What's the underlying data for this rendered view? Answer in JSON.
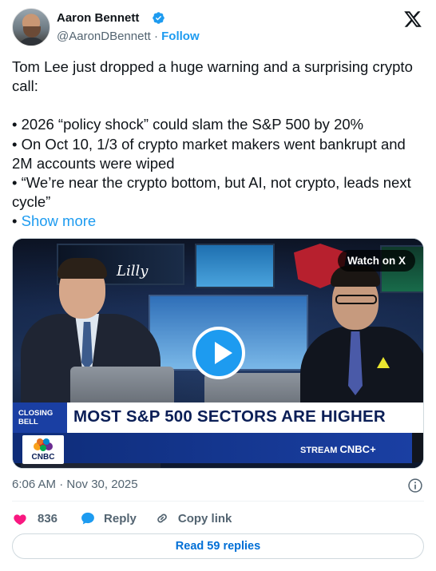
{
  "author": {
    "name": "Aaron Bennett",
    "handle": "@AaronDBennett",
    "separator": "·",
    "follow_label": "Follow",
    "verified_icon": "verified-badge-icon",
    "brand_icon": "x-logo-icon"
  },
  "tweet": {
    "lines": [
      "Tom Lee just dropped a huge warning and a surprising crypto call:",
      "• 2026 “policy shock” could slam the S&P 500 by 20%",
      "• On Oct 10, 1/3 of crypto market makers went bankrupt and 2M accounts were wiped",
      "• “We’re near the crypto bottom, but AI, not crypto, leads next cycle”"
    ],
    "show_more_prefix": "• ",
    "show_more_label": "Show more"
  },
  "media": {
    "watch_label": "Watch on X",
    "chyron_tag": "CLOSING BELL",
    "headline": "MOST S&P 500 SECTORS ARE HIGHER",
    "network": "CNBC",
    "stream_prefix": "STREAM",
    "stream_brand": "CNBC+",
    "screen_logo": "Lilly",
    "play_icon": "play-icon"
  },
  "meta": {
    "timestamp": "6:06 AM · Nov 30, 2025",
    "info_icon": "info-icon"
  },
  "actions": {
    "likes_count": "836",
    "reply_label": "Reply",
    "copy_label": "Copy link",
    "icons": [
      "heart-icon",
      "reply-bubble-icon",
      "link-icon"
    ]
  },
  "read_replies_label": "Read 59 replies",
  "colors": {
    "accent": "#1d9bf0",
    "like": "#f91880",
    "text": "#0f1419",
    "muted": "#536471"
  }
}
